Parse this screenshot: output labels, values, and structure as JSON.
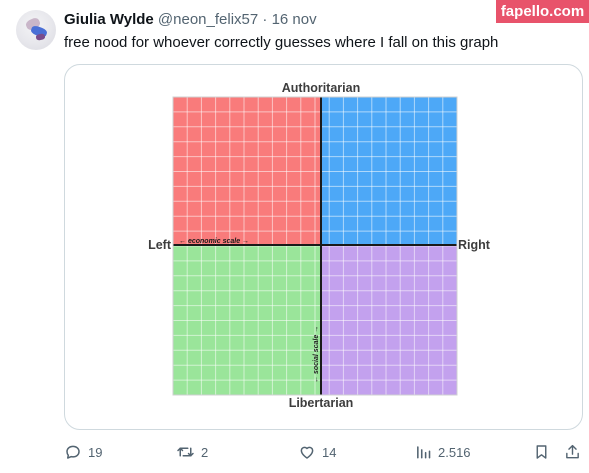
{
  "tweet": {
    "author_name": "Giulia Wylde",
    "handle": "@neon_felix57",
    "separator": "·",
    "date": "16 nov",
    "text": "free nood for whoever correctly guesses where I fall on this graph",
    "more_icon": "more-icon",
    "avatar_icon": "avatar"
  },
  "watermark": {
    "text": "fapello.com",
    "color": "#e8536b"
  },
  "compass": {
    "labels": {
      "top": "Authoritarian",
      "bottom": "Libertarian",
      "left": "Left",
      "right": "Right",
      "economic_axis": "economic scale",
      "social_axis": "social scale"
    },
    "quadrant_colors": {
      "authoritarian_left": "#f97b7b",
      "authoritarian_right": "#4da8f7",
      "libertarian_left": "#9ae59a",
      "libertarian_right": "#c3a1ee"
    },
    "grid_divisions": 20
  },
  "actions": {
    "reply": {
      "icon": "reply-icon",
      "count": "19"
    },
    "retweet": {
      "icon": "retweet-icon",
      "count": "2"
    },
    "like": {
      "icon": "like-icon",
      "count": "14"
    },
    "views": {
      "icon": "views-icon",
      "count": "2.516"
    },
    "bookmark": {
      "icon": "bookmark-icon"
    },
    "share": {
      "icon": "share-icon"
    }
  },
  "colors": {
    "text_primary": "#0f1419",
    "text_secondary": "#536471",
    "border": "#cfd9de"
  }
}
